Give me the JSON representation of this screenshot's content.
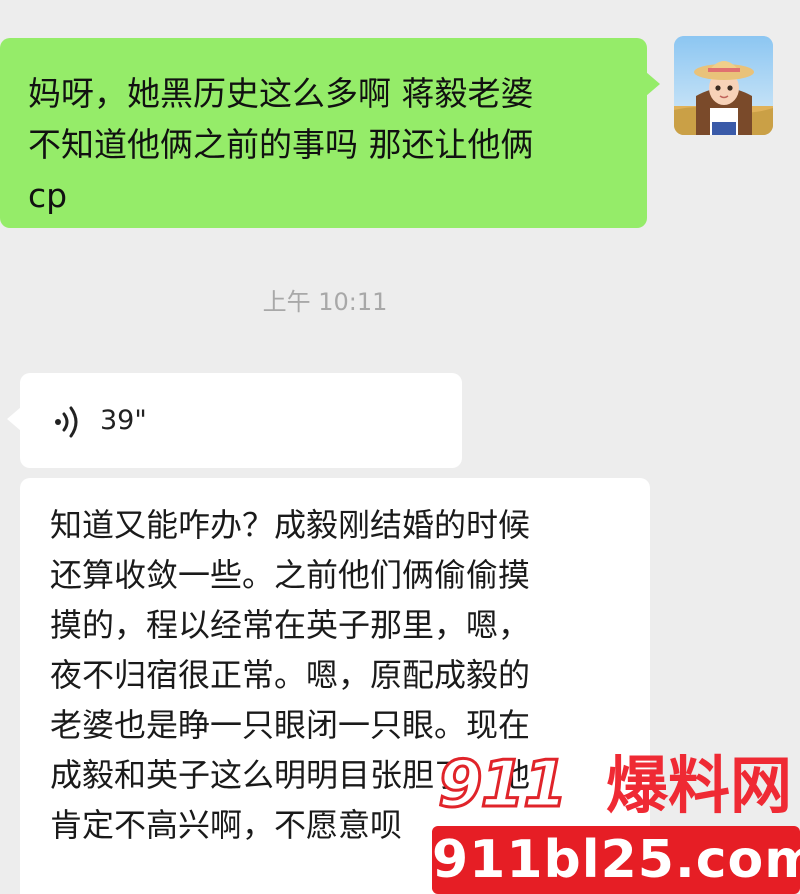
{
  "chat": {
    "outgoing_message": {
      "lines": [
        "妈呀，她黑历史这么多啊 蒋毅老婆",
        "不知道他俩之前的事吗 那还让他俩",
        "cp"
      ]
    },
    "timestamp": "上午 10:11",
    "voice_message": {
      "duration": "39\""
    },
    "incoming_text": {
      "lines": [
        "知道又能咋办？成毅刚结婚的时候",
        "还算收敛一些。之前他们俩偷偷摸",
        "摸的，程以经常在英子那里，嗯，",
        "夜不归宿很正常。嗯，原配成毅的",
        "老婆也是睁一只眼闭一只眼。现在",
        "成毅和英子这么明明目张胆了，他",
        "肯定不高兴啊，不愿意呗"
      ]
    }
  },
  "watermark": {
    "number": "911",
    "chinese": "爆料网",
    "url": "911bl25.com"
  },
  "colors": {
    "background": "#ededed",
    "outgoing_bubble": "#95ec69",
    "incoming_bubble": "#ffffff",
    "watermark_red": "#e61e25"
  }
}
